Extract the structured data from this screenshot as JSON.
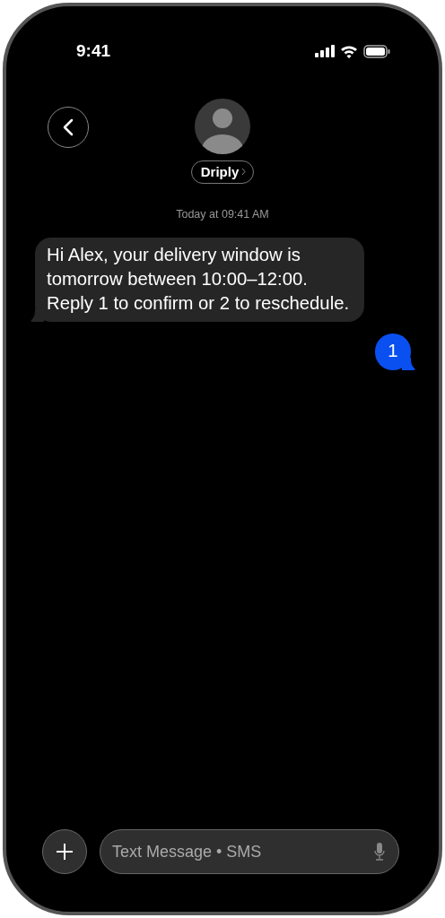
{
  "status_bar": {
    "time": "9:41"
  },
  "contact": {
    "name": "Driply"
  },
  "timestamp": "Today at 09:41 AM",
  "messages": [
    {
      "kind": "incoming",
      "text": "Hi Alex, your delivery window is tomorrow between 10:00–12:00. Reply 1 to confirm or 2 to reschedule."
    },
    {
      "kind": "outgoing",
      "text": "1"
    }
  ],
  "composer": {
    "placeholder": "Text Message • SMS"
  }
}
